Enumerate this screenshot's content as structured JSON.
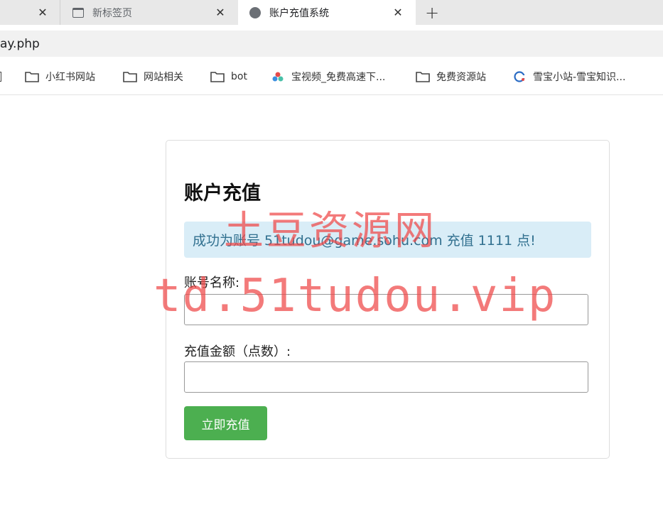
{
  "tabs": [
    {
      "label": "",
      "icon": "close-icon"
    },
    {
      "label": "新标签页",
      "icon": "tab-page-icon"
    },
    {
      "label": "账户充值系统",
      "icon": "globe-icon"
    }
  ],
  "address": {
    "url": "ay.php"
  },
  "bookmarks": [
    {
      "label": "小红书网站",
      "icon": "folder-icon"
    },
    {
      "label": "网站相关",
      "icon": "folder-icon"
    },
    {
      "label": "bot",
      "icon": "folder-icon"
    },
    {
      "label": "宝视频_免费高速下...",
      "icon": "site-icon"
    },
    {
      "label": "免费资源站",
      "icon": "folder-icon"
    },
    {
      "label": "雪宝小站-雪宝知识...",
      "icon": "site-icon"
    }
  ],
  "form": {
    "title": "账户充值",
    "alert": "成功为账号 51tudou@game.sohu.com 充值 1111 点!",
    "account_label": "账号名称:",
    "account_value": "",
    "amount_label": "充值金额（点数）:",
    "amount_value": "",
    "submit_label": "立即充值"
  },
  "watermark": {
    "line1": "土豆资源网",
    "line2": "td.51tudou.vip"
  },
  "colors": {
    "accent": "#4caf50",
    "alert_bg": "#d9edf7",
    "alert_text": "#31708f",
    "watermark": "#ee4646"
  }
}
